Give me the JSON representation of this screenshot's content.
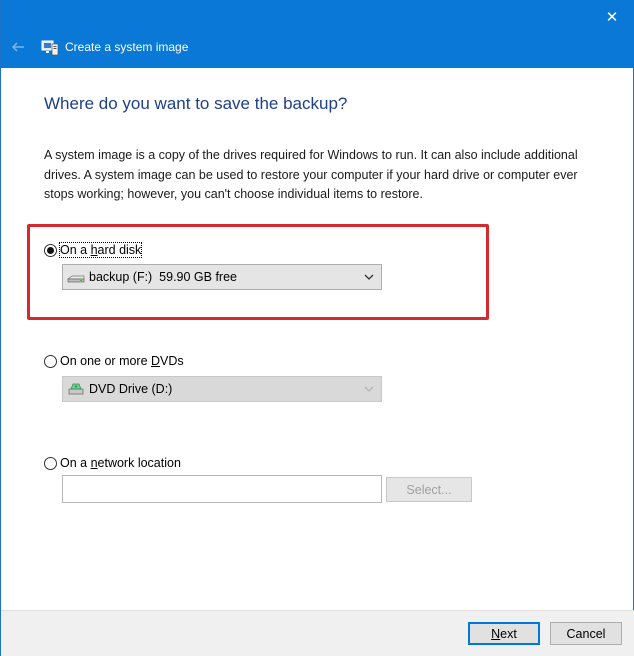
{
  "window": {
    "title": "Create a system image",
    "close_glyph": "✕"
  },
  "page": {
    "heading": "Where do you want to save the backup?",
    "description": "A system image is a copy of the drives required for Windows to run. It can also include additional drives. A system image can be used to restore your computer if your hard drive or computer ever stops working; however, you can't choose individual items to restore."
  },
  "options": {
    "hard_disk": {
      "label_pre": "On a ",
      "label_access": "h",
      "label_post": "ard disk",
      "selected": true,
      "drive_value": "backup (F:)  59.90 GB free"
    },
    "dvd": {
      "label_pre": "On one or more ",
      "label_access": "D",
      "label_post": "VDs",
      "selected": false,
      "drive_value": "DVD Drive (D:)"
    },
    "network": {
      "label_pre": "On a ",
      "label_access": "n",
      "label_post": "etwork location",
      "selected": false,
      "path_value": "",
      "select_button": "Select..."
    }
  },
  "footer": {
    "next_access": "N",
    "next_rest": "ext",
    "cancel": "Cancel"
  },
  "colors": {
    "titlebar": "#0a78d7",
    "heading": "#1e3f8a",
    "highlight": "#d42a2f"
  },
  "icons": {
    "back": "back-arrow-icon",
    "app": "system-image-icon",
    "hard_drive": "hard-drive-icon",
    "dvd_drive": "dvd-drive-icon",
    "dropdown": "chevron-down-icon"
  }
}
